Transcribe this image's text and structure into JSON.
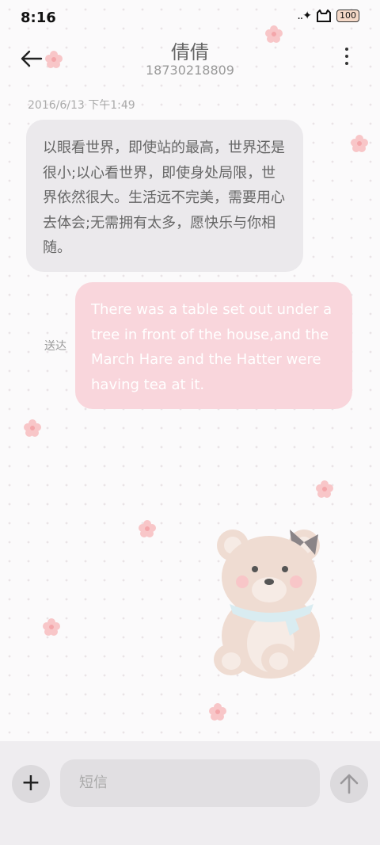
{
  "status_bar": {
    "time": "8:16",
    "signal": "..✦",
    "battery": "100"
  },
  "header": {
    "contact_name": "倩倩",
    "phone_number": "18730218809"
  },
  "thread": {
    "timestamp": "2016/6/13 下午1:49",
    "incoming_message": "以眼看世界，即使站的最高，世界还是很小;以心看世界，即使身处局限，世界依然很大。生活远不完美，需要用心去体会;无需拥有太多，愿快乐与你相随。",
    "outgoing_message": "There was a table set out under a tree in front of the house,and the March Hare and the Hatter were having tea at it.",
    "outgoing_status": "送达"
  },
  "composer": {
    "placeholder": "短信",
    "plus_label": "+"
  },
  "icons": [
    "back-arrow-icon",
    "more-vert-icon",
    "signal-icon",
    "battery-icon",
    "plus-icon",
    "send-arrow-icon",
    "flower-icon",
    "teddy-bear-icon"
  ],
  "colors": {
    "incoming_bubble": "#ebe9ec",
    "outgoing_bubble": "#f9d6dc",
    "composer_bar": "#efedf0"
  }
}
